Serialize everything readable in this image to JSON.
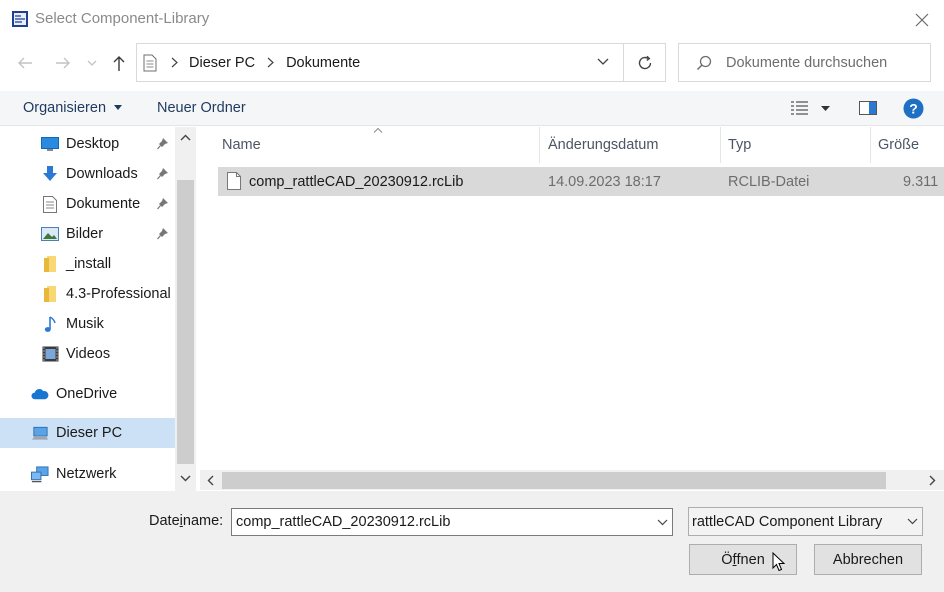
{
  "window": {
    "title": "Select Component-Library",
    "close_icon": "close-icon"
  },
  "nav": {
    "back_icon": "arrow-left-icon",
    "forward_icon": "arrow-right-icon",
    "recent_icon": "chevron-down-icon",
    "up_icon": "arrow-up-icon"
  },
  "address": {
    "breadcrumb": [
      "Dieser PC",
      "Dokumente"
    ],
    "refresh_icon": "refresh-icon"
  },
  "search": {
    "placeholder": "Dokumente durchsuchen"
  },
  "toolbar": {
    "organize_label": "Organisieren",
    "new_folder_label": "Neuer Ordner"
  },
  "sidebar": {
    "items": [
      {
        "label": "Desktop",
        "icon": "desktop-icon",
        "pinned": true
      },
      {
        "label": "Downloads",
        "icon": "downloads-icon",
        "pinned": true
      },
      {
        "label": "Dokumente",
        "icon": "documents-icon",
        "pinned": true
      },
      {
        "label": "Bilder",
        "icon": "pictures-icon",
        "pinned": true
      },
      {
        "label": "_install",
        "icon": "folder-icon",
        "pinned": false
      },
      {
        "label": "4.3-Professional",
        "icon": "folder-icon",
        "pinned": false
      },
      {
        "label": "Musik",
        "icon": "music-icon",
        "pinned": false
      },
      {
        "label": "Videos",
        "icon": "videos-icon",
        "pinned": false
      },
      {
        "label": "OneDrive",
        "icon": "onedrive-icon",
        "pinned": false
      },
      {
        "label": "Dieser PC",
        "icon": "computer-icon",
        "pinned": false,
        "selected": true
      },
      {
        "label": "Netzwerk",
        "icon": "network-icon",
        "pinned": false
      }
    ]
  },
  "filelist": {
    "columns": [
      "Name",
      "Änderungsdatum",
      "Typ",
      "Größe"
    ],
    "rows": [
      {
        "name": "comp_rattleCAD_20230912.rcLib",
        "date": "14.09.2023 18:17",
        "type": "RCLIB-Datei",
        "size": "9.311"
      }
    ]
  },
  "footer": {
    "filename_label_pre": "Date",
    "filename_label_ul": "i",
    "filename_label_post": "name:",
    "filename_value": "comp_rattleCAD_20230912.rcLib",
    "filetype_value": "rattleCAD Component Library",
    "open_pre": "Ö",
    "open_ul": "f",
    "open_post": "fnen",
    "cancel_label": "Abbrechen"
  },
  "colors": {
    "accent": "#0078d7",
    "selection": "#d9d9d9",
    "folder": "#f8d775"
  }
}
